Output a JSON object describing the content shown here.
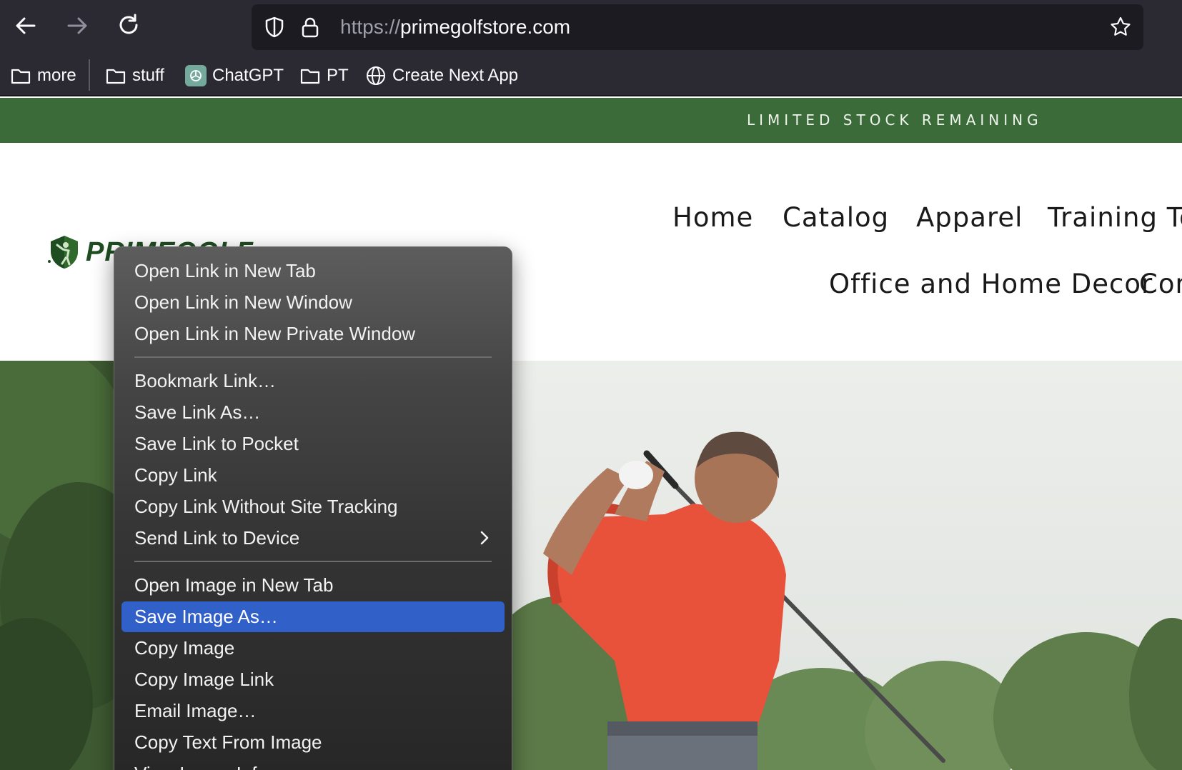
{
  "browser": {
    "url_scheme": "https://",
    "url_host": "primegolfstore.com"
  },
  "bookmarks": [
    {
      "label": "more",
      "icon": "folder-icon"
    },
    {
      "label": "stuff",
      "icon": "folder-icon"
    },
    {
      "label": "ChatGPT",
      "icon": "chatgpt-icon"
    },
    {
      "label": "PT",
      "icon": "folder-icon"
    },
    {
      "label": "Create Next App",
      "icon": "globe-icon"
    }
  ],
  "announcement": "LIMITED STOCK REMAINING",
  "logo": {
    "text": "PRIMEGOLF"
  },
  "nav": {
    "home": "Home",
    "catalog": "Catalog",
    "apparel": "Apparel",
    "training": "Training Too",
    "office": "Office and Home Decor",
    "contact": "Con"
  },
  "context_menu": {
    "items": [
      "Open Link in New Tab",
      "Open Link in New Window",
      "Open Link in New Private Window",
      "Bookmark Link…",
      "Save Link As…",
      "Save Link to Pocket",
      "Copy Link",
      "Copy Link Without Site Tracking",
      "Send Link to Device",
      "Open Image in New Tab",
      "Save Image As…",
      "Copy Image",
      "Copy Image Link",
      "Email Image…",
      "Copy Text From Image",
      "View Image Info"
    ],
    "highlighted": "Save Image As…"
  },
  "colors": {
    "announcement_bg": "#3b6b38",
    "highlight": "#3060c8",
    "brand_green": "#1f4d22"
  }
}
